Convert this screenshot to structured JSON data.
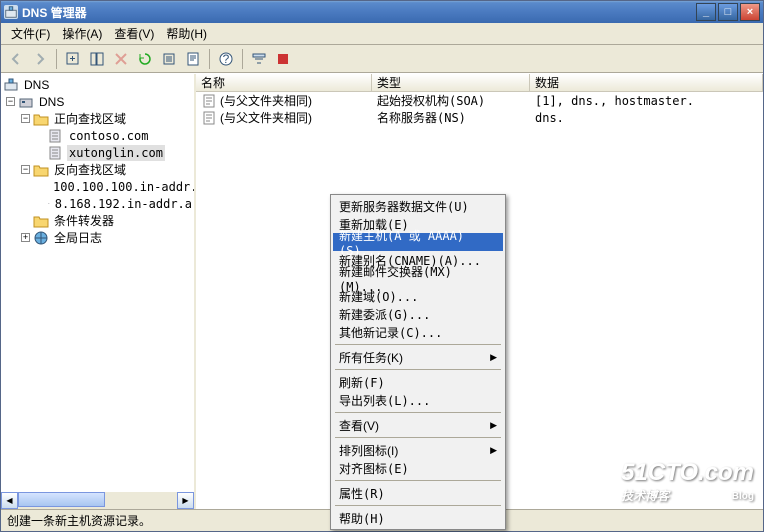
{
  "title": "DNS 管理器",
  "menubar": [
    "文件(F)",
    "操作(A)",
    "查看(V)",
    "帮助(H)"
  ],
  "tree": {
    "root": "DNS",
    "server": "DNS",
    "fwd_zone": "正向查找区域",
    "fwd_items": [
      "contoso.com",
      "xutonglin.com"
    ],
    "rev_zone": "反向查找区域",
    "rev_items": [
      "100.100.100.in-addr.",
      "8.168.192.in-addr.a"
    ],
    "cond_fwd": "条件转发器",
    "global_log": "全局日志"
  },
  "columns": {
    "name": "名称",
    "type": "类型",
    "data": "数据"
  },
  "rows": [
    {
      "name": "(与父文件夹相同)",
      "type": "起始授权机构(SOA)",
      "data": "[1], dns., hostmaster."
    },
    {
      "name": "(与父文件夹相同)",
      "type": "名称服务器(NS)",
      "data": "dns."
    }
  ],
  "ctx": {
    "update": "更新服务器数据文件(U)",
    "reload": "重新加载(E)",
    "newhost": "新建主机(A 或 AAAA)(S)...",
    "newcname": "新建别名(CNAME)(A)...",
    "newmx": "新建邮件交换器(MX)(M)...",
    "newdomain": "新建域(O)...",
    "newdelegation": "新建委派(G)...",
    "othernew": "其他新记录(C)...",
    "alltasks": "所有任务(K)",
    "refresh": "刷新(F)",
    "exportlist": "导出列表(L)...",
    "view": "查看(V)",
    "arrange": "排列图标(I)",
    "lineup": "对齐图标(E)",
    "prop": "属性(R)",
    "help": "帮助(H)"
  },
  "status": "创建一条新主机资源记录。",
  "watermark": {
    "site": "51CTO.com",
    "sub": "技术博客",
    "blog": "Blog"
  }
}
